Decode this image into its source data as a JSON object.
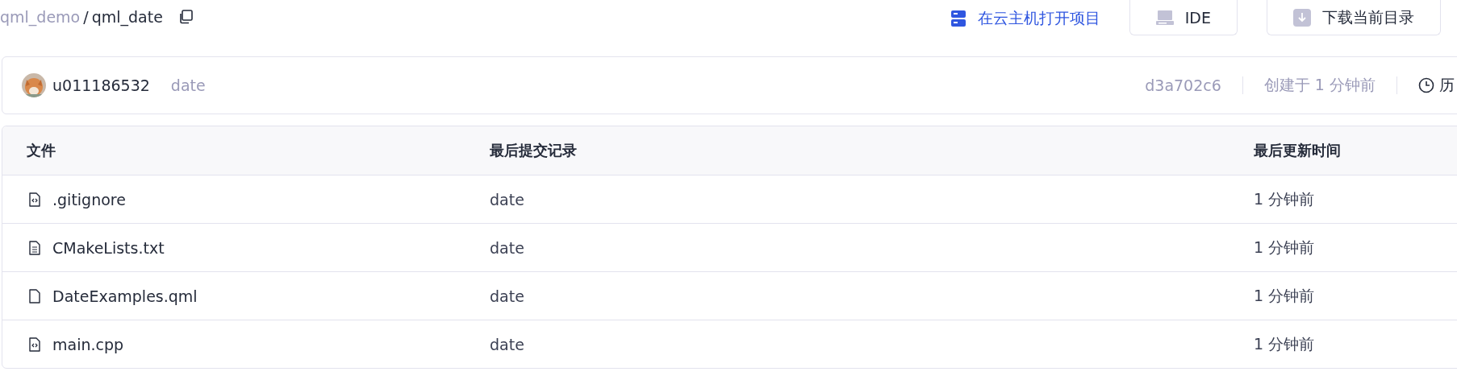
{
  "breadcrumb": {
    "parent": "qml_demo",
    "separator": "/",
    "current": "qml_date"
  },
  "actions": [
    {
      "kind": "link",
      "label": "在云主机打开项目"
    },
    {
      "kind": "ide",
      "label": "IDE"
    },
    {
      "kind": "download",
      "label": "下载当前目录"
    }
  ],
  "commit": {
    "author": "u011186532",
    "message": "date",
    "hash": "d3a702c6",
    "created": "创建于 1 分钟前",
    "history": "历"
  },
  "table": {
    "columns": [
      "文件",
      "最后提交记录",
      "最后更新时间"
    ],
    "rows": [
      {
        "kind": "code",
        "name": ".gitignore",
        "commit": "date",
        "updated": "1 分钟前"
      },
      {
        "kind": "text",
        "name": "CMakeLists.txt",
        "commit": "date",
        "updated": "1 分钟前"
      },
      {
        "kind": "file",
        "name": "DateExamples.qml",
        "commit": "date",
        "updated": "1 分钟前"
      },
      {
        "kind": "code",
        "name": "main.cpp",
        "commit": "date",
        "updated": "1 分钟前"
      }
    ]
  }
}
